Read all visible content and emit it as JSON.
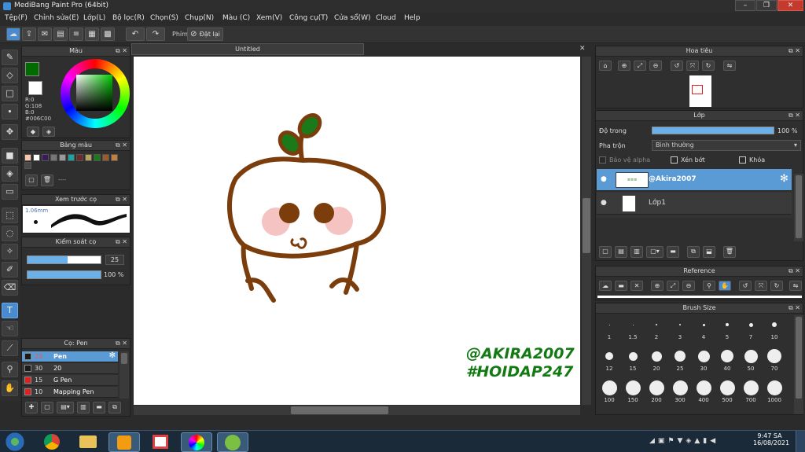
{
  "window": {
    "title": "MediBang Paint Pro (64bit)",
    "controls": [
      "–",
      "❐",
      "✕"
    ]
  },
  "menu": [
    "Tệp(F)",
    "Chỉnh sửa(E)",
    "Lớp(L)",
    "Bộ lọc(R)",
    "Chọn(S)",
    "Chụp(N)",
    "Màu (C)",
    "Xem(V)",
    "Công cụ(T)",
    "Cửa sổ(W)",
    "Cloud",
    "Help"
  ],
  "toolbar": {
    "shortcut_label": "Phím",
    "reset_label": "Đặt lại"
  },
  "color_panel": {
    "title": "Màu",
    "r": "R:0",
    "g": "G:108",
    "b": "B:0",
    "hex": "#006C00",
    "fg": "#006c00",
    "bg": "#ffffff"
  },
  "palette_panel": {
    "title": "Bảng màu",
    "colors": [
      "#f6c7a8",
      "#ffffff",
      "#3a1a5a",
      "#777777",
      "#9a9a9a",
      "#1aa3a3",
      "#6a2a2a",
      "#b4a35a",
      "#1a7a1a",
      "#9a5a2a",
      "#c08040",
      "#4a4a4a"
    ],
    "more": "----"
  },
  "preview_panel": {
    "title": "Xem trước cọ",
    "size": "1.06mm"
  },
  "control_panel": {
    "title": "Kiểm soát cọ",
    "size_value": "25",
    "opacity_value": "100 %",
    "size_fill": 0.55,
    "opacity_fill": 1.0
  },
  "brush_panel": {
    "title": "Cọ: Pen",
    "items": [
      {
        "size": "25",
        "name": "Pen",
        "color": "#1a1a1a",
        "selected": true
      },
      {
        "size": "30",
        "name": "20",
        "color": "#1a1a1a",
        "selected": false
      },
      {
        "size": "15",
        "name": "G Pen",
        "color": "#e02020",
        "selected": false
      },
      {
        "size": "10",
        "name": "Mapping Pen",
        "color": "#e02020",
        "selected": false
      }
    ]
  },
  "document": {
    "tab": "Untitled",
    "watermark1": "@AKIRA2007",
    "watermark2": "#HOIDAP247"
  },
  "navigator_panel": {
    "title": "Hoa tiêu"
  },
  "layer_panel": {
    "title": "Lớp",
    "opacity_label": "Độ trong",
    "opacity_value": "100 %",
    "opacity_fill": 1.0,
    "blend_label": "Pha trộn",
    "blend_value": "Bình thường",
    "protect_alpha": "Bảo vệ alpha",
    "clip": "Xén bớt",
    "lock": "Khóa",
    "layers": [
      {
        "name": "@Akira2007",
        "selected": true
      },
      {
        "name": "Lớp1",
        "selected": false
      }
    ]
  },
  "reference_panel": {
    "title": "Reference"
  },
  "brushsize_panel": {
    "title": "Brush Size",
    "sizes": [
      "1",
      "1.5",
      "2",
      "3",
      "4",
      "5",
      "7",
      "10",
      "12",
      "15",
      "20",
      "25",
      "30",
      "40",
      "50",
      "70",
      "100",
      "150",
      "200",
      "300",
      "400",
      "500",
      "700",
      "1000"
    ]
  },
  "taskbar": {
    "time": "9:47 SA",
    "date": "16/08/2021"
  }
}
